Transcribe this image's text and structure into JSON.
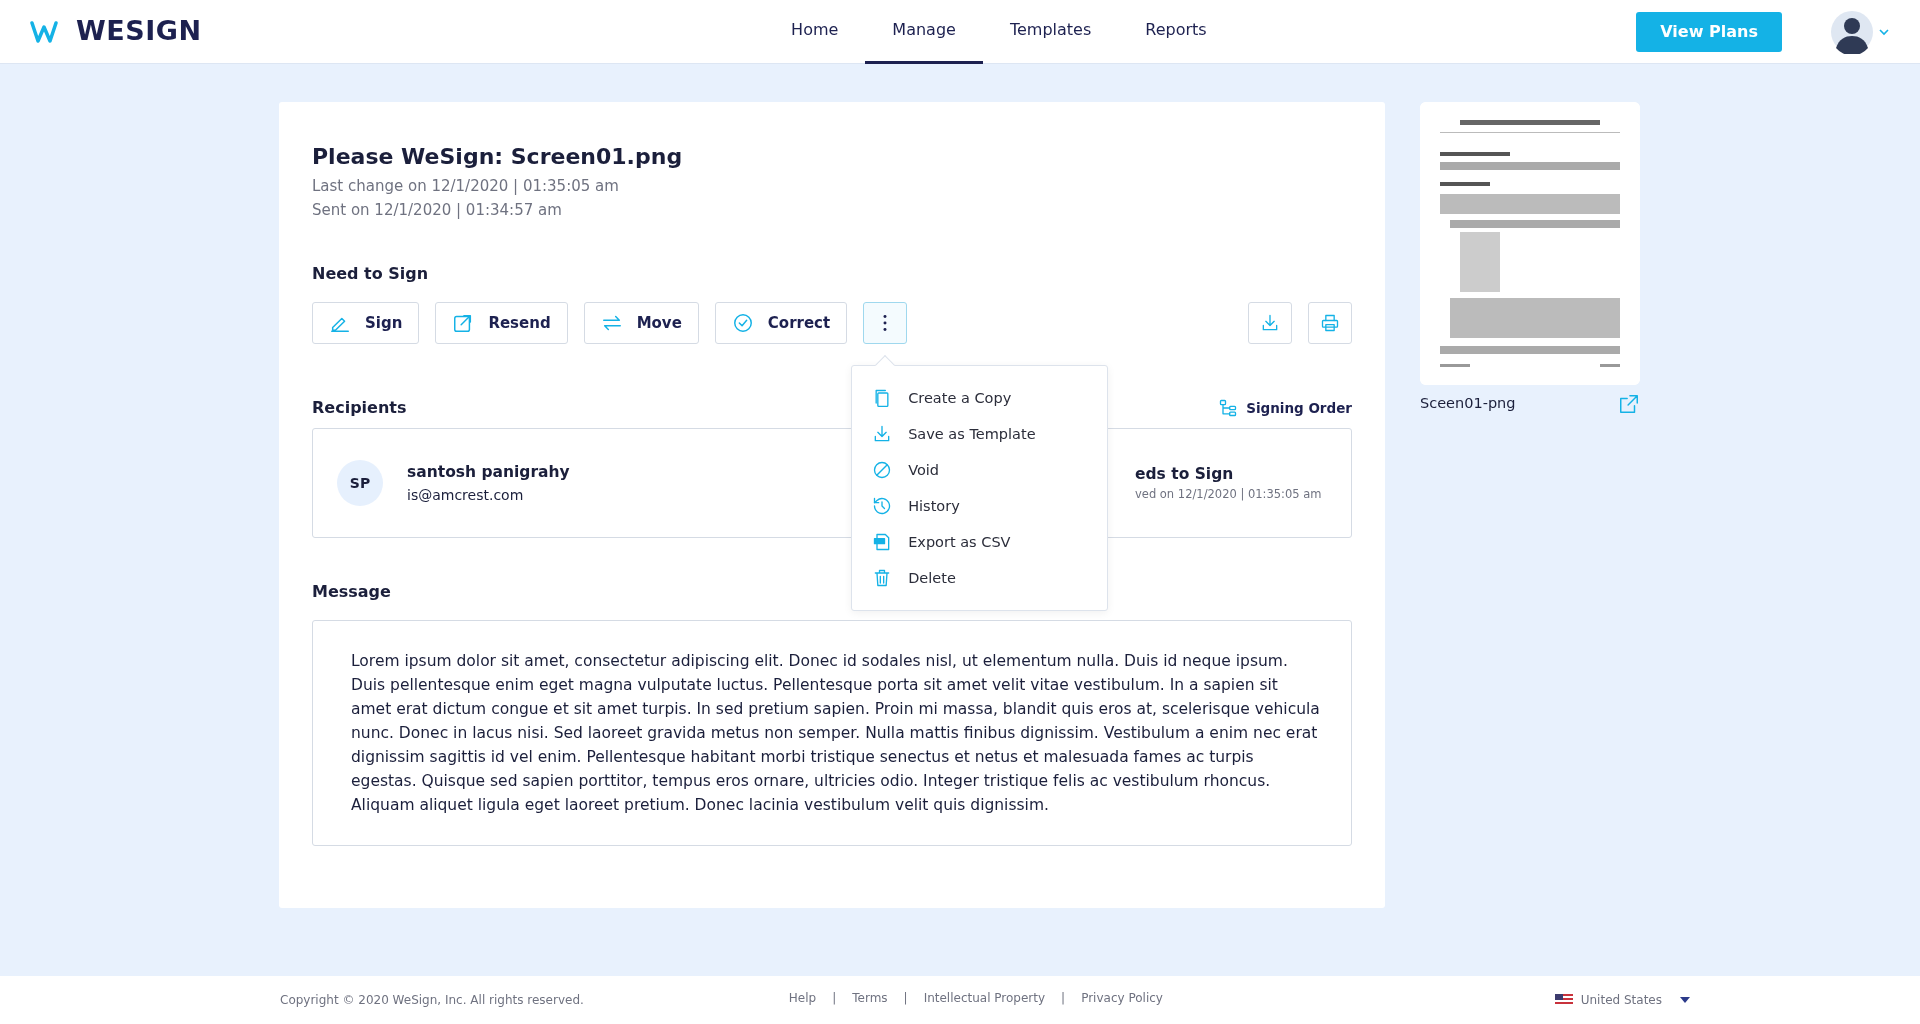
{
  "header": {
    "logo": "WESIGN",
    "nav": [
      {
        "label": "Home",
        "selected": false
      },
      {
        "label": "Manage",
        "selected": true
      },
      {
        "label": "Templates",
        "selected": false
      },
      {
        "label": "Reports",
        "selected": false
      }
    ],
    "plans_button": "View Plans"
  },
  "document": {
    "title": "Please WeSign: Screen01.png",
    "last_change": "Last change on 12/1/2020 | 01:35:05 am",
    "sent": "Sent on 12/1/2020 | 01:34:57 am"
  },
  "status_heading": "Need to Sign",
  "actions": [
    "Sign",
    "Resend",
    "Move",
    "Correct"
  ],
  "more_menu": {
    "expanded": true,
    "items": [
      "Create a Copy",
      "Save as Template",
      "Void",
      "History",
      "Export as CSV",
      "Delete"
    ]
  },
  "recipients": {
    "heading": "Recipients",
    "signing_order": "Signing Order",
    "list": [
      {
        "initials": "SP",
        "name": "santosh panigrahy",
        "email": "is@amcrest.com",
        "status": "eds to Sign",
        "detail": "ved on 12/1/2020 | 01:35:05 am"
      }
    ]
  },
  "message": {
    "heading": "Message",
    "text": "Lorem ipsum dolor sit amet, consectetur adipiscing elit. Donec id sodales nisl, ut elementum nulla. Duis id neque ipsum. Duis pellentesque enim eget magna vulputate luctus. Pellentesque porta sit amet velit vitae vestibulum. In a sapien sit amet erat dictum congue et sit amet turpis. In sed pretium sapien. Proin mi massa, blandit quis eros at, scelerisque vehicula nunc. Donec in lacus nisi. Sed laoreet gravida metus non semper. Nulla mattis finibus dignissim. Vestibulum a enim nec erat dignissim sagittis id vel enim. Pellentesque habitant morbi tristique senectus et netus et malesuada fames ac turpis egestas. Quisque sed sapien porttitor, tempus eros ornare, ultricies odio. Integer tristique felis ac vestibulum rhoncus. Aliquam aliquet ligula eget laoreet pretium. Donec lacinia vestibulum velit quis dignissim."
  },
  "preview": {
    "kind": "picture",
    "filename": "Sceen01-png"
  },
  "footer": {
    "copyright": "Copyright © 2020 WeSign, Inc. All rights reserved.",
    "links": [
      "Help",
      "Terms",
      "Intellectual Property",
      "Privacy Policy"
    ],
    "separator": "|",
    "region": "United States"
  }
}
